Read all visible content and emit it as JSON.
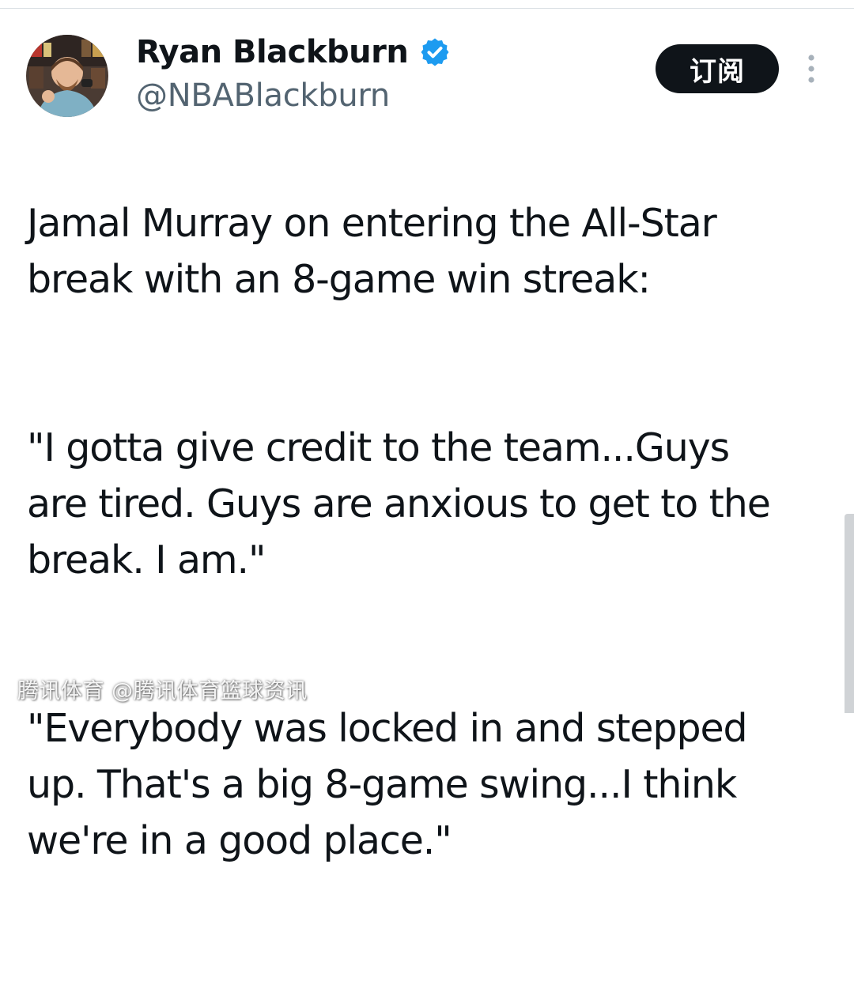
{
  "author": {
    "display_name": "Ryan Blackburn",
    "handle": "@NBABlackburn",
    "verified": true,
    "avatar_icon": "profile-photo"
  },
  "actions": {
    "subscribe_label": "订阅",
    "more_icon": "vertical-ellipsis-icon"
  },
  "tweet": {
    "paragraphs": [
      "Jamal Murray on entering the All-Star\nbreak with an 8-game win streak:",
      "\"I gotta give credit to the team...Guys\nare tired. Guys are anxious to get to the\nbreak. I am.\"",
      "\"Everybody was locked in and stepped\nup. That's a big 8-game swing...I think\nwe're in a good place.\""
    ]
  },
  "watermark": {
    "text": "腾讯体育 @腾讯体育篮球资讯"
  },
  "colors": {
    "text_primary": "#0f1419",
    "text_secondary": "#536471",
    "verified_blue": "#1d9bf0",
    "button_bg": "#0f1419",
    "button_text": "#ffffff"
  }
}
